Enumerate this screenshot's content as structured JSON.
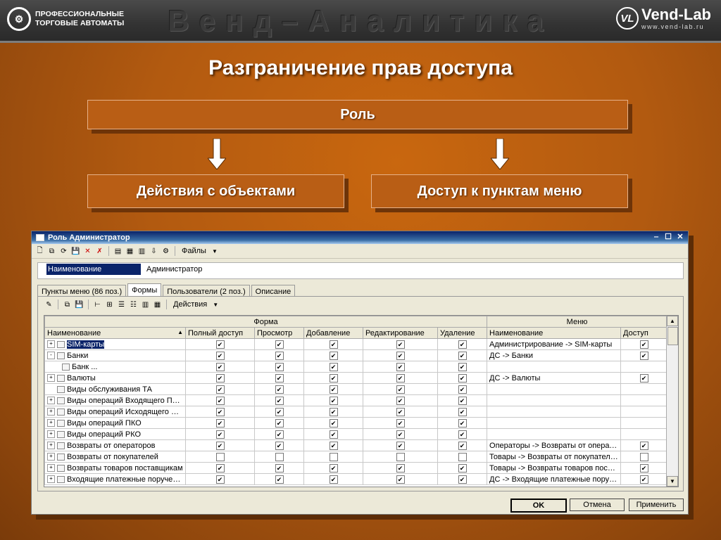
{
  "header": {
    "logo_left_mark": "⚙",
    "logo_left_line1": "ПРОФЕССИОНАЛЬНЫЕ",
    "logo_left_line2": "ТОРГОВЫЕ АВТОМАТЫ",
    "brand_title": "Венд–Аналитика",
    "logo_right_mark": "VL",
    "logo_right_name": "Vend-Lab",
    "logo_right_url": "www.vend-lab.ru"
  },
  "slide": {
    "title": "Разграничение прав доступа",
    "role_box": "Роль",
    "actions_box": "Действия с объектами",
    "menu_box": "Доступ к пунктам меню"
  },
  "window": {
    "title": "Роль Администратор",
    "toolbar_files": "Файлы",
    "name_label": "Наименование",
    "name_value": "Администратор",
    "tabs": [
      "Пункты меню (86 поз.)",
      "Формы",
      "Пользователи (2 поз.)",
      "Описание"
    ],
    "actions_label": "Действия",
    "group_form": "Форма",
    "group_menu": "Меню",
    "columns": [
      "Наименование",
      "Полный доступ",
      "Просмотр",
      "Добавление",
      "Редактирование",
      "Удаление",
      "Наименование",
      "Доступ"
    ],
    "rows": [
      {
        "name": "SIM-карты",
        "tree": "+",
        "flags": [
          true,
          true,
          true,
          true,
          true
        ],
        "menu": "Администрирование -> SIM-карты",
        "access": true,
        "selected": true
      },
      {
        "name": "Банки",
        "tree": "-",
        "flags": [
          true,
          true,
          true,
          true,
          true
        ],
        "menu": "ДС -> Банки",
        "access": true
      },
      {
        "name": "Банк ...",
        "tree": "child",
        "flags": [
          true,
          true,
          true,
          true,
          true
        ],
        "menu": "",
        "access": null
      },
      {
        "name": "Валюты",
        "tree": "+",
        "flags": [
          true,
          true,
          true,
          true,
          true
        ],
        "menu": "ДС -> Валюты",
        "access": true
      },
      {
        "name": "Виды обслуживания ТА",
        "tree": "none",
        "flags": [
          true,
          true,
          true,
          true,
          true
        ],
        "menu": "",
        "access": null
      },
      {
        "name": "Виды операций Входящего Платёжного",
        "tree": "+",
        "flags": [
          true,
          true,
          true,
          true,
          true
        ],
        "menu": "",
        "access": null
      },
      {
        "name": "Виды операций Исходящего Платёжного",
        "tree": "+",
        "flags": [
          true,
          true,
          true,
          true,
          true
        ],
        "menu": "",
        "access": null
      },
      {
        "name": "Виды операций ПКО",
        "tree": "+",
        "flags": [
          true,
          true,
          true,
          true,
          true
        ],
        "menu": "",
        "access": null
      },
      {
        "name": "Виды операций РКО",
        "tree": "+",
        "flags": [
          true,
          true,
          true,
          true,
          true
        ],
        "menu": "",
        "access": null
      },
      {
        "name": "Возвраты от операторов",
        "tree": "+",
        "flags": [
          true,
          true,
          true,
          true,
          true
        ],
        "menu": "Операторы -> Возвраты от операторов",
        "access": true
      },
      {
        "name": "Возвраты от покупателей",
        "tree": "+",
        "flags": [
          false,
          false,
          false,
          false,
          false
        ],
        "menu": "Товары -> Возвраты от покупателей",
        "access": false
      },
      {
        "name": "Возвраты товаров поставщикам",
        "tree": "+",
        "flags": [
          true,
          true,
          true,
          true,
          true
        ],
        "menu": "Товары -> Возвраты товаров поставщикам",
        "access": true
      },
      {
        "name": "Входящие платежные поручения",
        "tree": "+",
        "flags": [
          true,
          true,
          true,
          true,
          true
        ],
        "menu": "ДС -> Входящие платежные поручения",
        "access": true
      }
    ],
    "ok_label": "OK",
    "cancel_label": "Отмена",
    "apply_label": "Применить"
  }
}
